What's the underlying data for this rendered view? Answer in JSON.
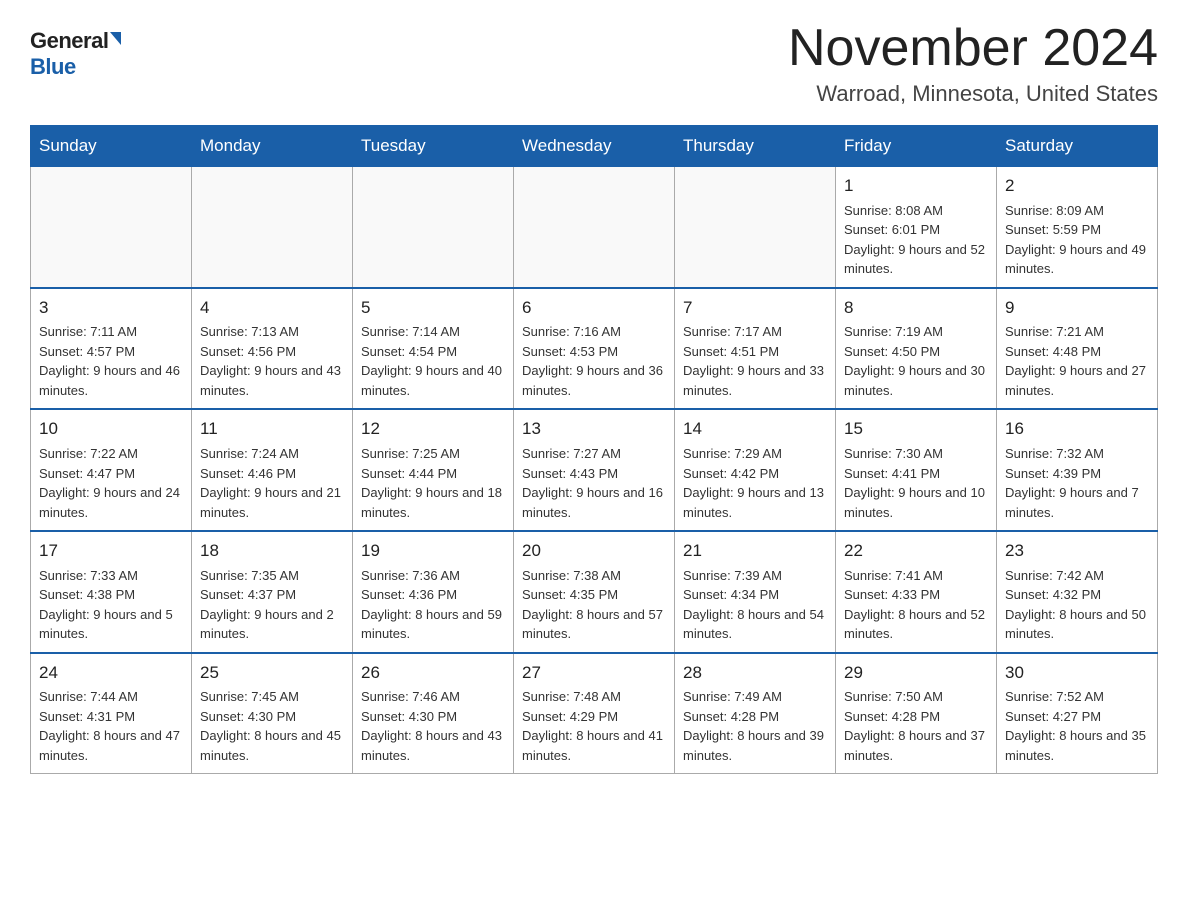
{
  "header": {
    "logo_general": "General",
    "logo_blue": "Blue",
    "month_title": "November 2024",
    "location": "Warroad, Minnesota, United States"
  },
  "days_of_week": [
    "Sunday",
    "Monday",
    "Tuesday",
    "Wednesday",
    "Thursday",
    "Friday",
    "Saturday"
  ],
  "weeks": [
    [
      {
        "day": "",
        "info": ""
      },
      {
        "day": "",
        "info": ""
      },
      {
        "day": "",
        "info": ""
      },
      {
        "day": "",
        "info": ""
      },
      {
        "day": "",
        "info": ""
      },
      {
        "day": "1",
        "info": "Sunrise: 8:08 AM\nSunset: 6:01 PM\nDaylight: 9 hours\nand 52 minutes."
      },
      {
        "day": "2",
        "info": "Sunrise: 8:09 AM\nSunset: 5:59 PM\nDaylight: 9 hours\nand 49 minutes."
      }
    ],
    [
      {
        "day": "3",
        "info": "Sunrise: 7:11 AM\nSunset: 4:57 PM\nDaylight: 9 hours\nand 46 minutes."
      },
      {
        "day": "4",
        "info": "Sunrise: 7:13 AM\nSunset: 4:56 PM\nDaylight: 9 hours\nand 43 minutes."
      },
      {
        "day": "5",
        "info": "Sunrise: 7:14 AM\nSunset: 4:54 PM\nDaylight: 9 hours\nand 40 minutes."
      },
      {
        "day": "6",
        "info": "Sunrise: 7:16 AM\nSunset: 4:53 PM\nDaylight: 9 hours\nand 36 minutes."
      },
      {
        "day": "7",
        "info": "Sunrise: 7:17 AM\nSunset: 4:51 PM\nDaylight: 9 hours\nand 33 minutes."
      },
      {
        "day": "8",
        "info": "Sunrise: 7:19 AM\nSunset: 4:50 PM\nDaylight: 9 hours\nand 30 minutes."
      },
      {
        "day": "9",
        "info": "Sunrise: 7:21 AM\nSunset: 4:48 PM\nDaylight: 9 hours\nand 27 minutes."
      }
    ],
    [
      {
        "day": "10",
        "info": "Sunrise: 7:22 AM\nSunset: 4:47 PM\nDaylight: 9 hours\nand 24 minutes."
      },
      {
        "day": "11",
        "info": "Sunrise: 7:24 AM\nSunset: 4:46 PM\nDaylight: 9 hours\nand 21 minutes."
      },
      {
        "day": "12",
        "info": "Sunrise: 7:25 AM\nSunset: 4:44 PM\nDaylight: 9 hours\nand 18 minutes."
      },
      {
        "day": "13",
        "info": "Sunrise: 7:27 AM\nSunset: 4:43 PM\nDaylight: 9 hours\nand 16 minutes."
      },
      {
        "day": "14",
        "info": "Sunrise: 7:29 AM\nSunset: 4:42 PM\nDaylight: 9 hours\nand 13 minutes."
      },
      {
        "day": "15",
        "info": "Sunrise: 7:30 AM\nSunset: 4:41 PM\nDaylight: 9 hours\nand 10 minutes."
      },
      {
        "day": "16",
        "info": "Sunrise: 7:32 AM\nSunset: 4:39 PM\nDaylight: 9 hours\nand 7 minutes."
      }
    ],
    [
      {
        "day": "17",
        "info": "Sunrise: 7:33 AM\nSunset: 4:38 PM\nDaylight: 9 hours\nand 5 minutes."
      },
      {
        "day": "18",
        "info": "Sunrise: 7:35 AM\nSunset: 4:37 PM\nDaylight: 9 hours\nand 2 minutes."
      },
      {
        "day": "19",
        "info": "Sunrise: 7:36 AM\nSunset: 4:36 PM\nDaylight: 8 hours\nand 59 minutes."
      },
      {
        "day": "20",
        "info": "Sunrise: 7:38 AM\nSunset: 4:35 PM\nDaylight: 8 hours\nand 57 minutes."
      },
      {
        "day": "21",
        "info": "Sunrise: 7:39 AM\nSunset: 4:34 PM\nDaylight: 8 hours\nand 54 minutes."
      },
      {
        "day": "22",
        "info": "Sunrise: 7:41 AM\nSunset: 4:33 PM\nDaylight: 8 hours\nand 52 minutes."
      },
      {
        "day": "23",
        "info": "Sunrise: 7:42 AM\nSunset: 4:32 PM\nDaylight: 8 hours\nand 50 minutes."
      }
    ],
    [
      {
        "day": "24",
        "info": "Sunrise: 7:44 AM\nSunset: 4:31 PM\nDaylight: 8 hours\nand 47 minutes."
      },
      {
        "day": "25",
        "info": "Sunrise: 7:45 AM\nSunset: 4:30 PM\nDaylight: 8 hours\nand 45 minutes."
      },
      {
        "day": "26",
        "info": "Sunrise: 7:46 AM\nSunset: 4:30 PM\nDaylight: 8 hours\nand 43 minutes."
      },
      {
        "day": "27",
        "info": "Sunrise: 7:48 AM\nSunset: 4:29 PM\nDaylight: 8 hours\nand 41 minutes."
      },
      {
        "day": "28",
        "info": "Sunrise: 7:49 AM\nSunset: 4:28 PM\nDaylight: 8 hours\nand 39 minutes."
      },
      {
        "day": "29",
        "info": "Sunrise: 7:50 AM\nSunset: 4:28 PM\nDaylight: 8 hours\nand 37 minutes."
      },
      {
        "day": "30",
        "info": "Sunrise: 7:52 AM\nSunset: 4:27 PM\nDaylight: 8 hours\nand 35 minutes."
      }
    ]
  ]
}
